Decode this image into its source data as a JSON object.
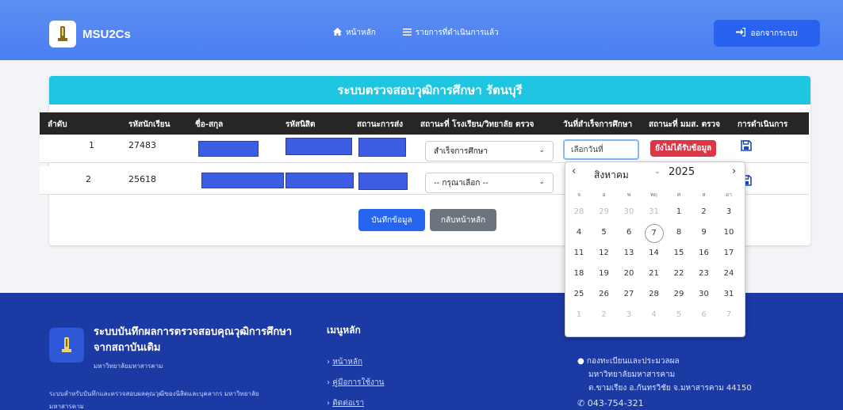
{
  "nav": {
    "brand": "MSU2Cs",
    "home": "หน้าหลัก",
    "done_list": "รายการที่ดำเนินการแล้ว",
    "logout": "ออกจากระบบ"
  },
  "card": {
    "title": "ระบบตรวจสอบวุฒิการศึกษา รัตนบุรี"
  },
  "table": {
    "headers": [
      "ลำดับ",
      "รหัสนักเรียน",
      "ชื่อ-สกุล",
      "รหัสนิสิต",
      "สถานะการส่ง",
      "สถานะที่ โรงเรียน/วิทยาลัย ตรวจ",
      "วันที่สำเร็จการศึกษา",
      "สถานะที่ มมส. ตรวจ",
      "การดำเนินการ"
    ],
    "rows": [
      {
        "order": "1",
        "student_id": "27483",
        "school_status": "สำเร็จการศึกษา",
        "date_placeholder": "เลือกวันที่",
        "msu_status": "ยังไม่ได้รับข้อมูล"
      },
      {
        "order": "2",
        "student_id": "25618",
        "school_status": "-- กรุณาเลือก --"
      }
    ]
  },
  "actions": {
    "save": "บันทึกข้อมูล",
    "back": "กลับหน้าหลัก"
  },
  "datepicker": {
    "month": "สิงหาคม",
    "year": "2025",
    "weekdays": [
      "จ",
      "อ",
      "พ",
      "พฤ",
      "ศ",
      "ส",
      "อา"
    ],
    "days": [
      [
        "28",
        "29",
        "30",
        "31",
        "1",
        "2",
        "3"
      ],
      [
        "4",
        "5",
        "6",
        "7",
        "8",
        "9",
        "10"
      ],
      [
        "11",
        "12",
        "13",
        "14",
        "15",
        "16",
        "17"
      ],
      [
        "18",
        "19",
        "20",
        "21",
        "22",
        "23",
        "24"
      ],
      [
        "25",
        "26",
        "27",
        "28",
        "29",
        "30",
        "31"
      ],
      [
        "1",
        "2",
        "3",
        "4",
        "5",
        "6",
        "7"
      ]
    ],
    "today": "7"
  },
  "footer": {
    "title": "ระบบบันทึกผลการตรวจสอบคุณวุฒิการศึกษาจากสถาบันเดิม",
    "subtitle": "มหาวิทยาลัยมหาสารคาม",
    "description": "ระบบสำหรับบันทึกและตรวจสอบผลคุณวุฒิของนิสิตและบุคลากร มหาวิทยาลัยมหาสารคาม",
    "menu_heading": "เมนูหลัก",
    "menu": [
      "หน้าหลัก",
      "คู่มือการใช้งาน",
      "ติดต่อเรา"
    ],
    "address": [
      "กองทะเบียนและประมวลผล",
      "มหาวิทยาลัยมหาสารคาม",
      "ต.ขามเรียง อ.กันทรวิชัย จ.มหาสารคาม 44150"
    ],
    "phone": "043-754-321"
  },
  "colors": {
    "nav": "#4a7ef2",
    "header": "#1ec6e2",
    "danger": "#dc3545",
    "primary": "#2565f0",
    "footer": "#1c3aa4"
  }
}
